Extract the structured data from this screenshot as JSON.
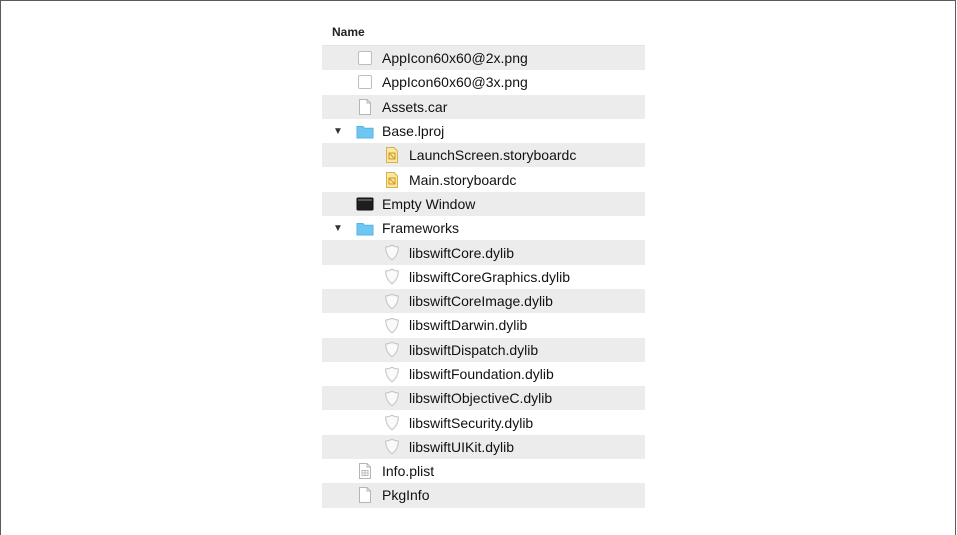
{
  "header": {
    "title": "Name"
  },
  "colors": {
    "folder": "#6ec6f2",
    "row_alt": "#ececec"
  },
  "rows": [
    {
      "label": "AppIcon60x60@2x.png",
      "icon": "image-file-icon",
      "level": 0
    },
    {
      "label": "AppIcon60x60@3x.png",
      "icon": "image-file-icon",
      "level": 0
    },
    {
      "label": "Assets.car",
      "icon": "document-icon",
      "level": 0
    },
    {
      "label": "Base.lproj",
      "icon": "folder-icon",
      "level": 0,
      "expanded": true
    },
    {
      "label": "LaunchScreen.storyboardc",
      "icon": "storyboard-icon",
      "level": 1
    },
    {
      "label": "Main.storyboardc",
      "icon": "storyboard-icon",
      "level": 1
    },
    {
      "label": "Empty Window",
      "icon": "executable-icon",
      "level": 0
    },
    {
      "label": "Frameworks",
      "icon": "folder-icon",
      "level": 0,
      "expanded": true
    },
    {
      "label": "libswiftCore.dylib",
      "icon": "library-shield-icon",
      "level": 1
    },
    {
      "label": "libswiftCoreGraphics.dylib",
      "icon": "library-shield-icon",
      "level": 1
    },
    {
      "label": "libswiftCoreImage.dylib",
      "icon": "library-shield-icon",
      "level": 1
    },
    {
      "label": "libswiftDarwin.dylib",
      "icon": "library-shield-icon",
      "level": 1
    },
    {
      "label": "libswiftDispatch.dylib",
      "icon": "library-shield-icon",
      "level": 1
    },
    {
      "label": "libswiftFoundation.dylib",
      "icon": "library-shield-icon",
      "level": 1
    },
    {
      "label": "libswiftObjectiveC.dylib",
      "icon": "library-shield-icon",
      "level": 1
    },
    {
      "label": "libswiftSecurity.dylib",
      "icon": "library-shield-icon",
      "level": 1
    },
    {
      "label": "libswiftUIKit.dylib",
      "icon": "library-shield-icon",
      "level": 1
    },
    {
      "label": "Info.plist",
      "icon": "plist-icon",
      "level": 0
    },
    {
      "label": "PkgInfo",
      "icon": "document-icon",
      "level": 0
    }
  ]
}
